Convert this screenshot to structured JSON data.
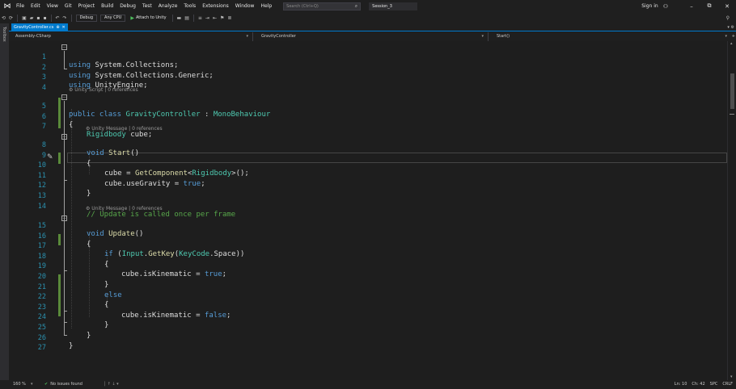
{
  "menubar": {
    "items": [
      "File",
      "Edit",
      "View",
      "Git",
      "Project",
      "Build",
      "Debug",
      "Test",
      "Analyze",
      "Tools",
      "Extensions",
      "Window",
      "Help"
    ],
    "search_placeholder": "Search (Ctrl+Q)",
    "session_name": "Session_3",
    "sign_in": "Sign in",
    "window_buttons": [
      "–",
      "⧉",
      "✕"
    ]
  },
  "toolbar": {
    "configuration": "Debug",
    "platform": "Any CPU",
    "attach_label": "Attach to Unity"
  },
  "toolbox_label": "Toolbox",
  "tab": {
    "filename": "GravityController.cs",
    "pin": "⊕",
    "close": "✕"
  },
  "navbar": {
    "project": "Assembly-CSharp",
    "class": "GravityController",
    "member": "Start()"
  },
  "editor": {
    "lens": {
      "class": "Unity Script | 0 references",
      "start": "Unity Message | 0 references",
      "update": "Unity Message | 0 references"
    },
    "line_numbers": [
      "1",
      "2",
      "3",
      "4",
      "5",
      "6",
      "7",
      "8",
      "9",
      "10",
      "11",
      "12",
      "13",
      "14",
      "15",
      "16",
      "17",
      "18",
      "19",
      "20",
      "21",
      "22",
      "23",
      "24",
      "25",
      "26",
      "27"
    ],
    "lines": {
      "l1_kw": "using",
      "l1_rest": " System.Collections;",
      "l2_kw": "using",
      "l2_rest": " System.Collections.Generic;",
      "l3_kw": "using",
      "l3_rest": " UnityEngine;",
      "l5_kw": "public class",
      "l5_sp": " ",
      "l5_cls": "GravityController",
      "l5_colon": " : ",
      "l5_base": "MonoBehaviour",
      "l6": "{",
      "l7_ty": "Rigidbody",
      "l7_rest": " cube;",
      "l8_kw": "void",
      "l8_sp": " ",
      "l8_me": "Start",
      "l8_rest": "()",
      "l9": "{",
      "l10_a": "cube = ",
      "l10_me": "GetComponent",
      "l10_b": "<",
      "l10_ty": "Rigidbody",
      "l10_c": ">();",
      "l11_a": "cube.useGravity = ",
      "l11_kw": "true",
      "l11_b": ";",
      "l12": "}",
      "l14": "// Update is called once per frame",
      "l15_kw": "void",
      "l15_sp": " ",
      "l15_me": "Update",
      "l15_rest": "()",
      "l16": "{",
      "l17_kw": "if",
      "l17_a": " (",
      "l17_ty1": "Input",
      "l17_dot": ".",
      "l17_me": "GetKey",
      "l17_p": "(",
      "l17_ty2": "KeyCode",
      "l17_b": ".Space))",
      "l18": "{",
      "l19_a": "cube.isKinematic = ",
      "l19_kw": "true",
      "l19_b": ";",
      "l20": "}",
      "l21_kw": "else",
      "l22": "{",
      "l23_a": "cube.isKinematic = ",
      "l23_kw": "false",
      "l23_b": ";",
      "l24": "}",
      "l25": "}",
      "l26": "}"
    }
  },
  "statusbar": {
    "zoom": "160 %",
    "issues": "No issues found",
    "line": "Ln: 10",
    "col": "Ch: 42",
    "mode": "SPC",
    "eol": "CRLF"
  },
  "colors": {
    "keyword": "#569cd6",
    "type": "#4ec9b0",
    "method": "#dcdcaa",
    "comment": "#57a64a",
    "line_number": "#2b91af",
    "accent": "#007acc"
  }
}
